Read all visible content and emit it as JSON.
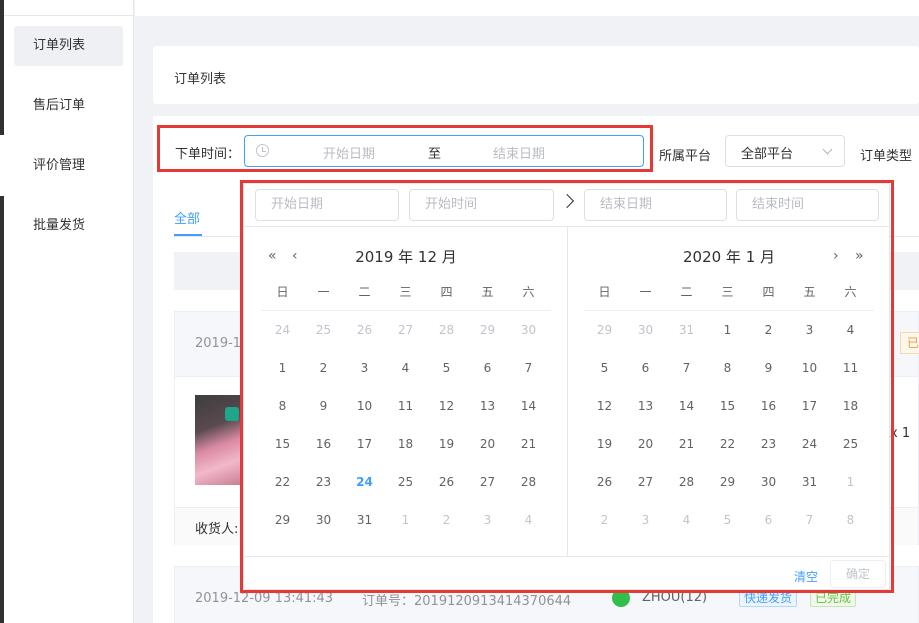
{
  "sidebar": {
    "items": [
      {
        "label": "订单列表",
        "active": true
      },
      {
        "label": "售后订单"
      },
      {
        "label": "评价管理"
      },
      {
        "label": "批量发货"
      }
    ]
  },
  "page": {
    "title": "订单列表"
  },
  "filters": {
    "order_time_label": "下单时间：",
    "start_placeholder": "开始日期",
    "range_separator": "至",
    "end_placeholder": "结束日期",
    "platform_label": "所属平台",
    "platform_value": "全部平台",
    "order_type_label": "订单类型"
  },
  "tabs": {
    "all": "全部"
  },
  "orders": [
    {
      "date": "2019-1",
      "receiver_label": "收货人:",
      "qty": "x 1",
      "badge": "已"
    },
    {
      "date": "2019-12-09 13:41:43",
      "order_no": "订单号：2019120913414370644",
      "buyer": "ZHOU(12)",
      "tag1": "快递发货",
      "tag2": "已完成"
    }
  ],
  "picker": {
    "start_date_placeholder": "开始日期",
    "start_time_placeholder": "开始时间",
    "end_date_placeholder": "结束日期",
    "end_time_placeholder": "结束时间",
    "weekdays": [
      "日",
      "一",
      "二",
      "三",
      "四",
      "五",
      "六"
    ],
    "left": {
      "title": "2019 年 12 月",
      "prev_year": "«",
      "prev_month": "‹",
      "days": [
        [
          "24",
          "25",
          "26",
          "27",
          "28",
          "29",
          "30"
        ],
        [
          "1",
          "2",
          "3",
          "4",
          "5",
          "6",
          "7"
        ],
        [
          "8",
          "9",
          "10",
          "11",
          "12",
          "13",
          "14"
        ],
        [
          "15",
          "16",
          "17",
          "18",
          "19",
          "20",
          "21"
        ],
        [
          "22",
          "23",
          "24",
          "25",
          "26",
          "27",
          "28"
        ],
        [
          "29",
          "30",
          "31",
          "1",
          "2",
          "3",
          "4"
        ]
      ],
      "today": "24"
    },
    "right": {
      "title": "2020 年 1 月",
      "next_month": "›",
      "next_year": "»",
      "days": [
        [
          "29",
          "30",
          "31",
          "1",
          "2",
          "3",
          "4"
        ],
        [
          "5",
          "6",
          "7",
          "8",
          "9",
          "10",
          "11"
        ],
        [
          "12",
          "13",
          "14",
          "15",
          "16",
          "17",
          "18"
        ],
        [
          "19",
          "20",
          "21",
          "22",
          "23",
          "24",
          "25"
        ],
        [
          "26",
          "27",
          "28",
          "29",
          "30",
          "31",
          "1"
        ],
        [
          "2",
          "3",
          "4",
          "5",
          "6",
          "7",
          "8"
        ]
      ]
    },
    "clear_label": "清空",
    "confirm_label": "确定"
  },
  "colors": {
    "accent": "#409eff",
    "highlight_outline": "#e53935"
  }
}
